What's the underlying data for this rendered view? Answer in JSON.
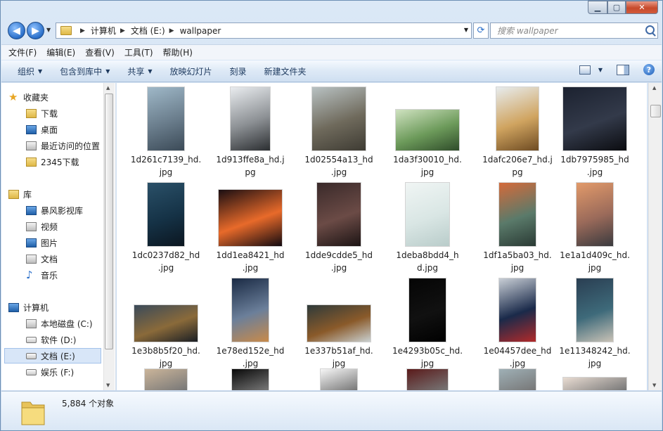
{
  "address": {
    "crumbs": [
      "计算机",
      "文档 (E:)",
      "wallpaper"
    ],
    "search_placeholder": "搜索 wallpaper"
  },
  "menu": [
    "文件(F)",
    "编辑(E)",
    "查看(V)",
    "工具(T)",
    "帮助(H)"
  ],
  "toolbar": {
    "organize": "组织",
    "include_in_library": "包含到库中",
    "share": "共享",
    "slideshow": "放映幻灯片",
    "burn": "刻录",
    "new_folder": "新建文件夹"
  },
  "sidebar": {
    "favorites_title": "收藏夹",
    "favorites": [
      "下载",
      "桌面",
      "最近访问的位置",
      "2345下载"
    ],
    "libraries_title": "库",
    "libraries": [
      "暴风影视库",
      "视频",
      "图片",
      "文档",
      "音乐"
    ],
    "computer_title": "计算机",
    "drives": [
      "本地磁盘 (C:)",
      "软件 (D:)",
      "文档 (E:)",
      "娱乐 (F:)"
    ]
  },
  "files": [
    {
      "line1": "1d261c7139_hd.",
      "line2": "jpg",
      "colors": [
        "#9fb8c8",
        "#6a7d8c",
        "#3b4a57"
      ]
    },
    {
      "line1": "1d913ffe8a_hd.j",
      "line2": "pg",
      "colors": [
        "#e9ecef",
        "#8c9094",
        "#2b2e31"
      ]
    },
    {
      "line1": "1d02554a13_hd",
      "line2": ".jpg",
      "colors": [
        "#b8c1c2",
        "#6f6a5c",
        "#3e3b33"
      ]
    },
    {
      "line1": "1da3f30010_hd.",
      "line2": "jpg",
      "colors": [
        "#cfe2c0",
        "#6c9a5a",
        "#2f4c2a"
      ]
    },
    {
      "line1": "1dafc206e7_hd.j",
      "line2": "pg",
      "colors": [
        "#e7ecee",
        "#d0a460",
        "#6e4b22"
      ]
    },
    {
      "line1": "1db7975985_hd",
      "line2": ".jpg",
      "colors": [
        "#1c2230",
        "#333a4a",
        "#0b0c10"
      ]
    },
    {
      "line1": "1dc0237d82_hd",
      "line2": ".jpg",
      "colors": [
        "#2a5068",
        "#153246",
        "#0b1620"
      ]
    },
    {
      "line1": "1dd1ea8421_hd",
      "line2": ".jpg",
      "colors": [
        "#1a0e12",
        "#e86a2a",
        "#120a10"
      ]
    },
    {
      "line1": "1dde9cdde5_hd",
      "line2": ".jpg",
      "colors": [
        "#3a2a2a",
        "#6b4b46",
        "#1c1414"
      ]
    },
    {
      "line1": "1deba8bdd4_h",
      "line2": "d.jpg",
      "colors": [
        "#f0f5f4",
        "#d9e6e4",
        "#b9ccca"
      ]
    },
    {
      "line1": "1df1a5ba03_hd.",
      "line2": "jpg",
      "colors": [
        "#d46a3a",
        "#5a7a6a",
        "#2a3a34"
      ]
    },
    {
      "line1": "1e1a1d409c_hd.",
      "line2": "jpg",
      "colors": [
        "#e29a6a",
        "#9a6a5a",
        "#3a3a3e"
      ]
    },
    {
      "line1": "1e3b8b5f20_hd.",
      "line2": "jpg",
      "colors": [
        "#3a4a5a",
        "#8a6a3a",
        "#1a1e24"
      ]
    },
    {
      "line1": "1e78ed152e_hd",
      "line2": ".jpg",
      "colors": [
        "#1a2a44",
        "#6b7f9a",
        "#c88a4a"
      ]
    },
    {
      "line1": "1e337b51af_hd.",
      "line2": "jpg",
      "colors": [
        "#2e3a3a",
        "#8a5a2a",
        "#c9d0d0"
      ]
    },
    {
      "line1": "1e4293b05c_hd.",
      "line2": "jpg",
      "colors": [
        "#050505",
        "#111111",
        "#000000"
      ]
    },
    {
      "line1": "1e04457dee_hd",
      "line2": ".jpg",
      "colors": [
        "#c9cfd6",
        "#1a2a4a",
        "#b22a2a"
      ]
    },
    {
      "line1": "1e11348242_hd.",
      "line2": "jpg",
      "colors": [
        "#2a3e52",
        "#3e6a7a",
        "#c9c2b6"
      ]
    }
  ],
  "partial_row_colors": [
    "#cbb59a",
    "#080808",
    "#f6f6f6",
    "#5a1a1a",
    "#9fb0b6",
    "#e9dcd2"
  ],
  "status": {
    "count": "5,884 个对象"
  }
}
